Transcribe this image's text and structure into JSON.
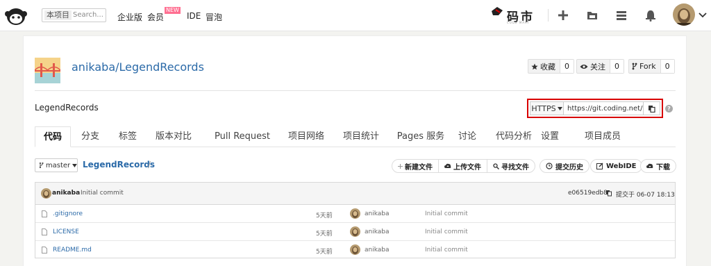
{
  "nav": {
    "search_scope": "本项目",
    "search_placeholder": "Search...",
    "links": [
      "企业版",
      "会员",
      "IDE",
      "冒泡"
    ],
    "new_badge": "NEW",
    "brand": "码市",
    "brand_sub": "CODE MART",
    "icons": [
      "plus-icon",
      "folder-icon",
      "server-icon",
      "bell-icon"
    ]
  },
  "repo": {
    "title": "anikaba/LegendRecords",
    "description": "LegendRecords",
    "star_label": "收藏",
    "star_count": "0",
    "watch_label": "关注",
    "watch_count": "0",
    "fork_label": "Fork",
    "fork_count": "0"
  },
  "clone": {
    "protocol": "HTTPS",
    "url": "https://git.coding.net/anikaba/LegendRecords.git"
  },
  "tabs": [
    "代码",
    "分支",
    "标签",
    "版本对比",
    "Pull Request",
    "项目网络",
    "项目统计",
    "Pages 服务",
    "讨论",
    "代码分析",
    "设置",
    "项目成员"
  ],
  "toolbar": {
    "branch": "master",
    "crumb": "LegendRecords",
    "crumb_sep": "/",
    "actions": [
      "新建文件",
      "上传文件",
      "寻找文件"
    ],
    "history": "提交历史",
    "webide": "WebIDE",
    "download": "下载"
  },
  "commit": {
    "user": "anikaba",
    "message": "Initial commit",
    "hash": "e06519edb8",
    "date": "提交于 06-07 18:13"
  },
  "files": [
    {
      "name": ".gitignore",
      "age": "5天前",
      "user": "anikaba",
      "message": "Initial commit"
    },
    {
      "name": "LICENSE",
      "age": "5天前",
      "user": "anikaba",
      "message": "Initial commit"
    },
    {
      "name": "README.md",
      "age": "5天前",
      "user": "anikaba",
      "message": "Initial commit"
    }
  ],
  "colors": {
    "accent": "#2b6aa8",
    "highlight": "#d80000",
    "badge": "#ff6f91"
  }
}
